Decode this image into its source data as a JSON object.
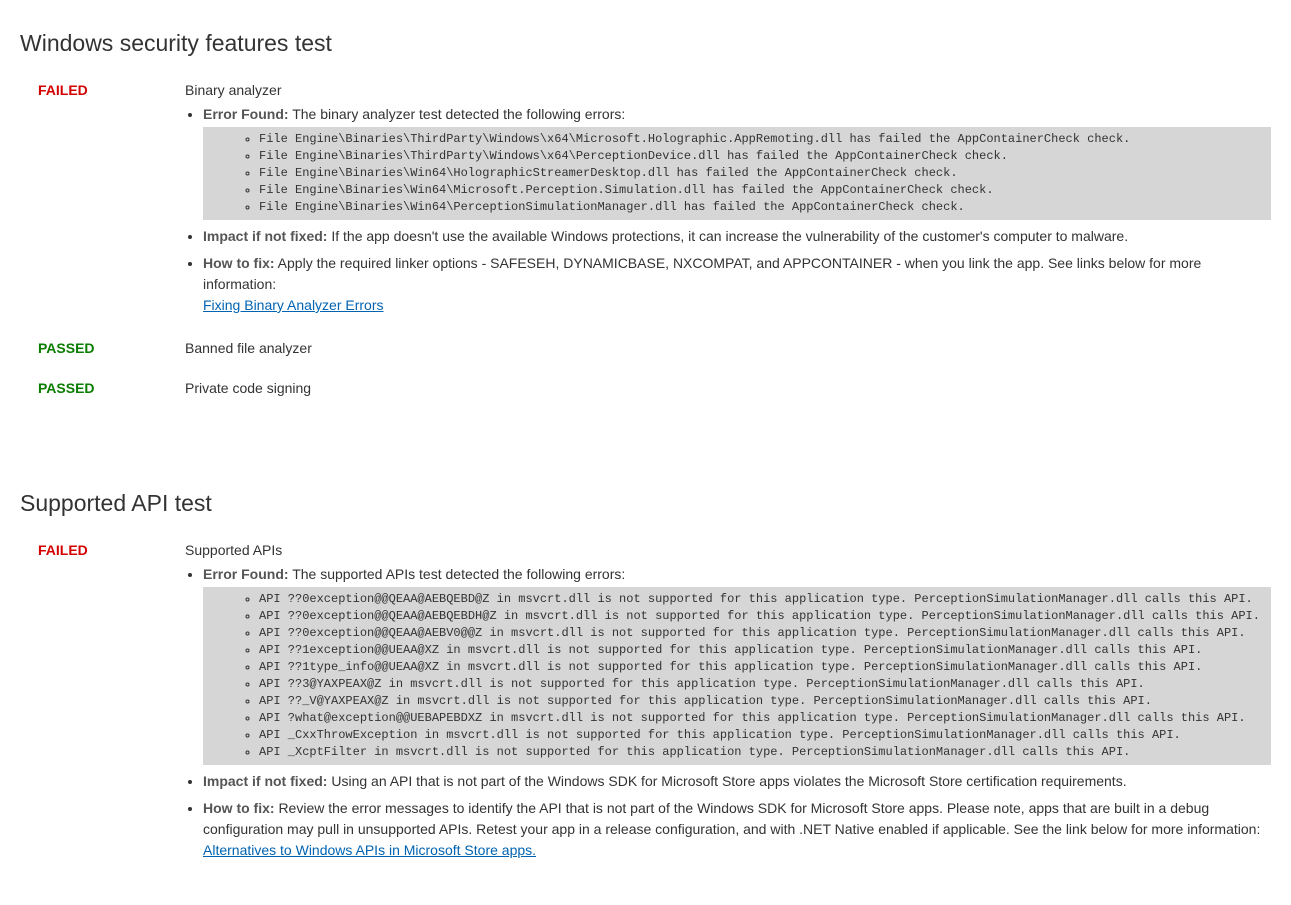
{
  "sections": [
    {
      "title": "Windows security features test",
      "tests": [
        {
          "status": "FAILED",
          "name": "Binary analyzer",
          "error_label": "Error Found:",
          "error_intro": "The binary analyzer test detected the following errors:",
          "error_lines": [
            "File Engine\\Binaries\\ThirdParty\\Windows\\x64\\Microsoft.Holographic.AppRemoting.dll has failed the AppContainerCheck check.",
            "File Engine\\Binaries\\ThirdParty\\Windows\\x64\\PerceptionDevice.dll has failed the AppContainerCheck check.",
            "File Engine\\Binaries\\Win64\\HolographicStreamerDesktop.dll has failed the AppContainerCheck check.",
            "File Engine\\Binaries\\Win64\\Microsoft.Perception.Simulation.dll has failed the AppContainerCheck check.",
            "File Engine\\Binaries\\Win64\\PerceptionSimulationManager.dll has failed the AppContainerCheck check."
          ],
          "impact_label": "Impact if not fixed:",
          "impact_text": "If the app doesn't use the available Windows protections, it can increase the vulnerability of the customer's computer to malware.",
          "fix_label": "How to fix:",
          "fix_text": "Apply the required linker options - SAFESEH, DYNAMICBASE, NXCOMPAT, and APPCONTAINER - when you link the app. See links below for more information:",
          "fix_link_text": "Fixing Binary Analyzer Errors"
        },
        {
          "status": "PASSED",
          "name": "Banned file analyzer"
        },
        {
          "status": "PASSED",
          "name": "Private code signing"
        }
      ]
    },
    {
      "title": "Supported API test",
      "tests": [
        {
          "status": "FAILED",
          "name": "Supported APIs",
          "error_label": "Error Found:",
          "error_intro": "The supported APIs test detected the following errors:",
          "error_lines": [
            "API ??0exception@@QEAA@AEBQEBD@Z in msvcrt.dll is not supported for this application type. PerceptionSimulationManager.dll calls this API.",
            "API ??0exception@@QEAA@AEBQEBDH@Z in msvcrt.dll is not supported for this application type. PerceptionSimulationManager.dll calls this API.",
            "API ??0exception@@QEAA@AEBV0@@Z in msvcrt.dll is not supported for this application type. PerceptionSimulationManager.dll calls this API.",
            "API ??1exception@@UEAA@XZ in msvcrt.dll is not supported for this application type. PerceptionSimulationManager.dll calls this API.",
            "API ??1type_info@@UEAA@XZ in msvcrt.dll is not supported for this application type. PerceptionSimulationManager.dll calls this API.",
            "API ??3@YAXPEAX@Z in msvcrt.dll is not supported for this application type. PerceptionSimulationManager.dll calls this API.",
            "API ??_V@YAXPEAX@Z in msvcrt.dll is not supported for this application type. PerceptionSimulationManager.dll calls this API.",
            "API ?what@exception@@UEBAPEBDXZ in msvcrt.dll is not supported for this application type. PerceptionSimulationManager.dll calls this API.",
            "API _CxxThrowException in msvcrt.dll is not supported for this application type. PerceptionSimulationManager.dll calls this API.",
            "API _XcptFilter in msvcrt.dll is not supported for this application type. PerceptionSimulationManager.dll calls this API."
          ],
          "impact_label": "Impact if not fixed:",
          "impact_text": "Using an API that is not part of the Windows SDK for Microsoft Store apps violates the Microsoft Store certification requirements.",
          "fix_label": "How to fix:",
          "fix_text": "Review the error messages to identify the API that is not part of the Windows SDK for Microsoft Store apps. Please note, apps that are built in a debug configuration may pull in unsupported APIs. Retest your app in a release configuration, and with .NET Native enabled if applicable. See the link below for more information:",
          "fix_link_text": "Alternatives to Windows APIs in Microsoft Store apps."
        }
      ]
    }
  ]
}
